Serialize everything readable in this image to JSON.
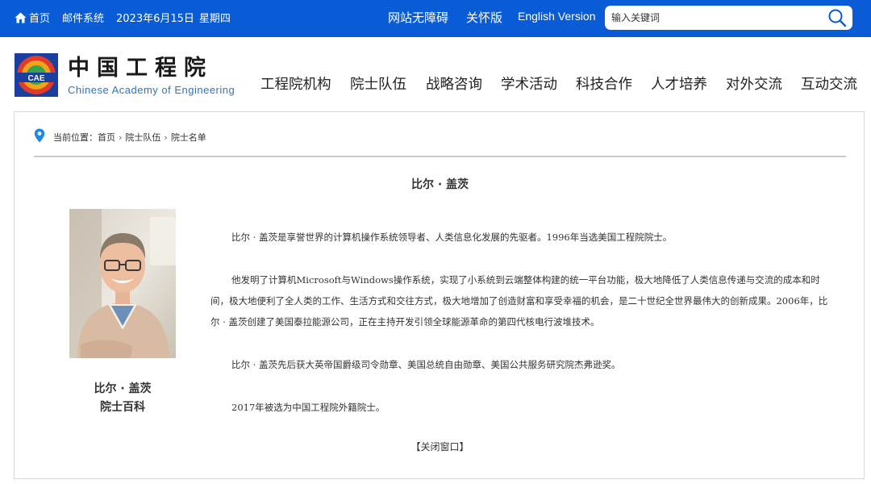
{
  "topbar": {
    "home": "首页",
    "mail": "邮件系统",
    "date": "2023年6月15日",
    "weekday": "星期四",
    "accessibility": "网站无障碍",
    "care_mode": "关怀版",
    "english": "English Version",
    "search_placeholder": "输入关键词"
  },
  "header": {
    "logo_cn": "中国工程院",
    "logo_en": "Chinese Academy of Engineering",
    "logo_badge": "CAE"
  },
  "nav": [
    "工程院机构",
    "院士队伍",
    "战略咨询",
    "学术活动",
    "科技合作",
    "人才培养",
    "对外交流",
    "互动交流"
  ],
  "breadcrumb": {
    "label": "当前位置：",
    "items": [
      "首页",
      "院士队伍",
      "院士名单"
    ]
  },
  "article": {
    "title": "比尔 · 盖茨",
    "name": "比尔 · 盖茨",
    "baike": "院士百科",
    "paragraphs": [
      "比尔 · 盖茨是享誉世界的计算机操作系统领导者、人类信息化发展的先驱者。1996年当选美国工程院院士。",
      "他发明了计算机Microsoft与Windows操作系统，实现了小系统到云端整体构建的统一平台功能，极大地降低了人类信息传递与交流的成本和时间，极大地便利了全人类的工作、生活方式和交往方式，极大地增加了创造财富和享受幸福的机会，是二十世纪全世界最伟大的创新成果。2006年，比尔 · 盖茨创建了美国泰拉能源公司，正在主持开发引领全球能源革命的第四代核电行波堆技术。",
      "比尔 · 盖茨先后获大英帝国爵级司令勋章、美国总统自由勋章、美国公共服务研究院杰弗逊奖。",
      "2017年被选为中国工程院外籍院士。"
    ],
    "close": "【关闭窗口】"
  },
  "colors": {
    "brand_blue": "#0a5bd6",
    "logo_en_blue": "#2b73c9",
    "pin_blue": "#1e88e5"
  },
  "icons": [
    "home-icon",
    "search-icon",
    "location-pin-icon",
    "cae-logo"
  ]
}
